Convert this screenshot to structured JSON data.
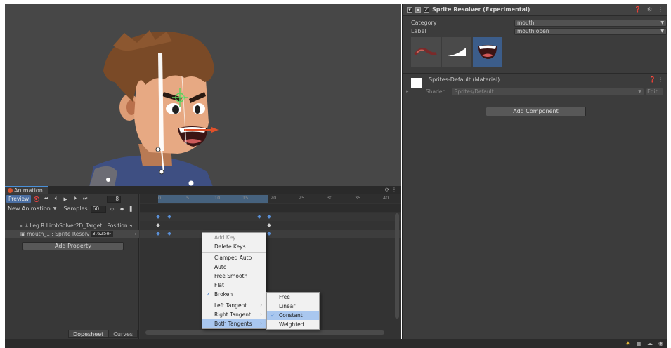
{
  "inspector": {
    "component_title": "Sprite Resolver (Experimental)",
    "category_label": "Category",
    "category_value": "mouth",
    "label_label": "Label",
    "label_value": "mouth open",
    "header_icons": [
      "help-icon",
      "settings-icon",
      "more-icon"
    ],
    "material_title": "Sprites-Default (Material)",
    "shader_label": "Shader",
    "shader_value": "Sprites/Default",
    "edit_label": "Edit...",
    "add_component_label": "Add Component"
  },
  "animation": {
    "tab_label": "Animation",
    "preview_label": "Preview",
    "frame_value": "8",
    "clip_name": "New Animation",
    "samples_label": "Samples",
    "samples_value": "60",
    "properties": [
      {
        "label": "Leg R LimbSolver2D_Target : Position"
      },
      {
        "label": "mouth_1 : Sprite Resolv",
        "value": "3.625e-"
      }
    ],
    "add_property_label": "Add Property",
    "bottom_tabs": [
      "Dopesheet",
      "Curves"
    ],
    "ruler_ticks": [
      "0",
      "5",
      "10",
      "15",
      "20",
      "25",
      "30",
      "35",
      "40"
    ]
  },
  "context_menu": {
    "items": [
      {
        "label": "Add Key",
        "disabled": true
      },
      {
        "label": "Delete Keys"
      },
      {
        "separator": true
      },
      {
        "label": "Clamped Auto"
      },
      {
        "label": "Auto"
      },
      {
        "label": "Free Smooth"
      },
      {
        "label": "Flat"
      },
      {
        "label": "Broken",
        "checked": true
      },
      {
        "separator": true
      },
      {
        "label": "Left Tangent",
        "submenu": true
      },
      {
        "label": "Right Tangent",
        "submenu": true
      },
      {
        "label": "Both Tangents",
        "submenu": true,
        "highlighted": true
      }
    ]
  },
  "submenu": {
    "items": [
      {
        "label": "Free"
      },
      {
        "label": "Linear"
      },
      {
        "label": "Constant",
        "checked": true,
        "highlighted": true
      },
      {
        "label": "Weighted"
      }
    ]
  },
  "colors": {
    "accent": "#4a6ea2",
    "menu_highlight": "#a9c7ef",
    "record": "#e44444",
    "bone_arrow": "#e0502a"
  }
}
